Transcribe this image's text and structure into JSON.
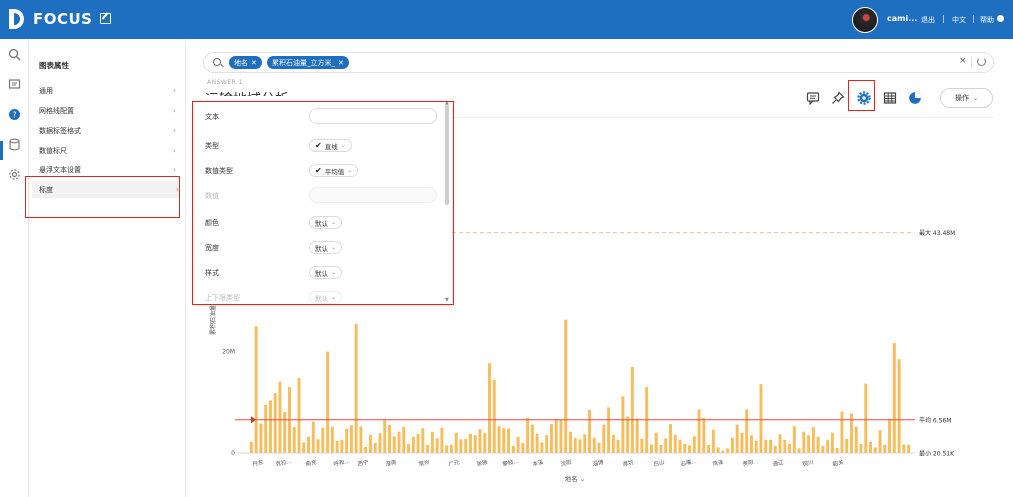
{
  "topbar": {
    "brand": "FOCUS",
    "user": "cami...",
    "logout": "退出",
    "language": "中文",
    "help": "帮助"
  },
  "properties": {
    "title": "图表属性",
    "items": [
      {
        "label": "通用"
      },
      {
        "label": "网格线配置"
      },
      {
        "label": "数据标签格式"
      },
      {
        "label": "数值标尺"
      },
      {
        "label": "悬浮文本设置"
      },
      {
        "label": "标度"
      }
    ]
  },
  "search": {
    "chips": [
      {
        "label": "地名"
      },
      {
        "label": "累积石油量_立方米_"
      }
    ]
  },
  "answer": {
    "label": "ANSWER 1",
    "title": "运输地域分析",
    "ops_label": "操作"
  },
  "dialog": {
    "rows": [
      {
        "label": "文本",
        "control": "input",
        "value": ""
      },
      {
        "label": "类型",
        "control": "select",
        "value": "直线",
        "checked": true
      },
      {
        "label": "数值类型",
        "control": "select",
        "value": "平均值",
        "checked": true
      },
      {
        "label": "数值",
        "control": "input",
        "value": "",
        "disabled": true
      },
      {
        "label": "颜色",
        "control": "select",
        "value": "默认"
      },
      {
        "label": "宽度",
        "control": "select",
        "value": "默认"
      },
      {
        "label": "样式",
        "control": "select",
        "value": "默认"
      },
      {
        "label": "上下限类型",
        "control": "select",
        "value": "默认",
        "disabled": true
      }
    ]
  },
  "colors": {
    "primary": "#1f6fc0",
    "bar": "#f7bd5c",
    "highlight": "#e0261f",
    "maxline": "#f5b38a",
    "avgline": "#e64b3c"
  },
  "chart_data": {
    "type": "bar",
    "xlabel": "地名",
    "ylabel": "累积石油量",
    "y_ticks": [
      "0",
      "20M"
    ],
    "ylim": [
      0,
      45000000
    ],
    "x_tick_labels": [
      "丹东",
      "克拉...",
      "南充",
      "呼和...",
      "西宁",
      "淮南",
      "常州",
      "广元",
      "张掖",
      "攀枝...",
      "本溪",
      "沈阳",
      "淄博",
      "潍坊",
      "白山",
      "石嘴...",
      "菏泽",
      "贵阳",
      "通辽",
      "铜川",
      "韶关"
    ],
    "reference_lines": [
      {
        "label": "最大 43.48M",
        "value": 43480000
      },
      {
        "label": "平均 6.56M",
        "value": 6560000
      },
      {
        "label": "最小 20.51K",
        "value": 20510
      }
    ],
    "values": [
      2200000,
      25000000,
      5800000,
      9500000,
      10400000,
      11800000,
      14100000,
      8100000,
      13000000,
      5100000,
      14800000,
      2100000,
      3200000,
      6200000,
      2700000,
      5000000,
      20000000,
      5200000,
      2400000,
      2600000,
      4800000,
      5500000,
      25500000,
      5200000,
      1200000,
      3600000,
      2000000,
      3900000,
      6600000,
      5500000,
      3300000,
      4200000,
      5200000,
      1800000,
      3200000,
      3800000,
      4900000,
      1600000,
      4200000,
      2900000,
      5000000,
      1500000,
      1600000,
      4000000,
      2700000,
      2800000,
      3800000,
      3500000,
      4700000,
      3900000,
      17700000,
      14400000,
      5300000,
      4900000,
      4800000,
      1400000,
      3200000,
      2000000,
      6900000,
      5600000,
      3800000,
      2100000,
      3500000,
      5700000,
      6700000,
      6500000,
      26300000,
      4200000,
      3000000,
      2700000,
      3700000,
      8500000,
      3000000,
      2000000,
      5600000,
      9000000,
      3600000,
      2600000,
      11200000,
      7200000,
      17000000,
      6800000,
      2800000,
      13000000,
      1700000,
      4000000,
      1600000,
      2900000,
      5700000,
      3600000,
      2600000,
      1800000,
      1500000,
      3300000,
      8600000,
      6900000,
      1600000,
      4600000,
      1100000,
      500000,
      900000,
      3000000,
      5600000,
      4000000,
      8600000,
      3500000,
      2400000,
      13600000,
      2600000,
      2600000,
      1400000,
      3700000,
      2600000,
      1800000,
      5300000,
      900000,
      4200000,
      3500000,
      5100000,
      3200000,
      1400000,
      2600000,
      4000000,
      1000000,
      8200000,
      2800000,
      7800000,
      5200000,
      1800000,
      13700000,
      2200000,
      1100000,
      4500000,
      1600000,
      6700000,
      21700000,
      18500000,
      1700000,
      1600000
    ]
  }
}
